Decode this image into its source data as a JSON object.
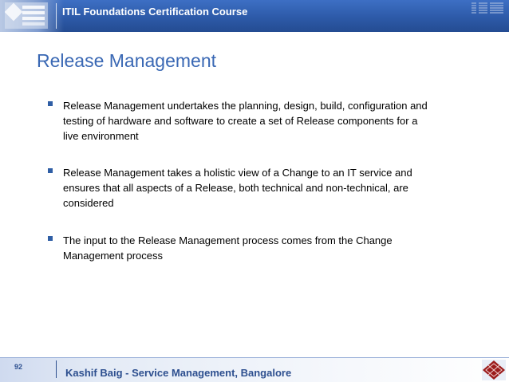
{
  "header": {
    "title": "ITIL Foundations Certification Course",
    "brand": "IBM"
  },
  "slide": {
    "title": "Release Management",
    "bullets": [
      {
        "lines": [
          "Release Management undertakes the planning, design, build, configuration and",
          "testing of hardware and software to create a set of Release components for a",
          "live environment"
        ]
      },
      {
        "lines": [
          "Release Management takes a holistic view of a Change to an IT service and",
          "ensures that all aspects of a Release, both technical and non-technical, are",
          "considered"
        ]
      },
      {
        "lines": [
          "The input to the Release Management process comes from the Change",
          "Management process"
        ]
      }
    ]
  },
  "footer": {
    "page_number": "92",
    "text": "Kashif Baig - Service Management, Bangalore"
  },
  "colors": {
    "header_blue": "#2d5aa8",
    "title_blue": "#3a68b4",
    "footer_text": "#2d4f8f",
    "emblem_red": "#9b1c1c"
  }
}
